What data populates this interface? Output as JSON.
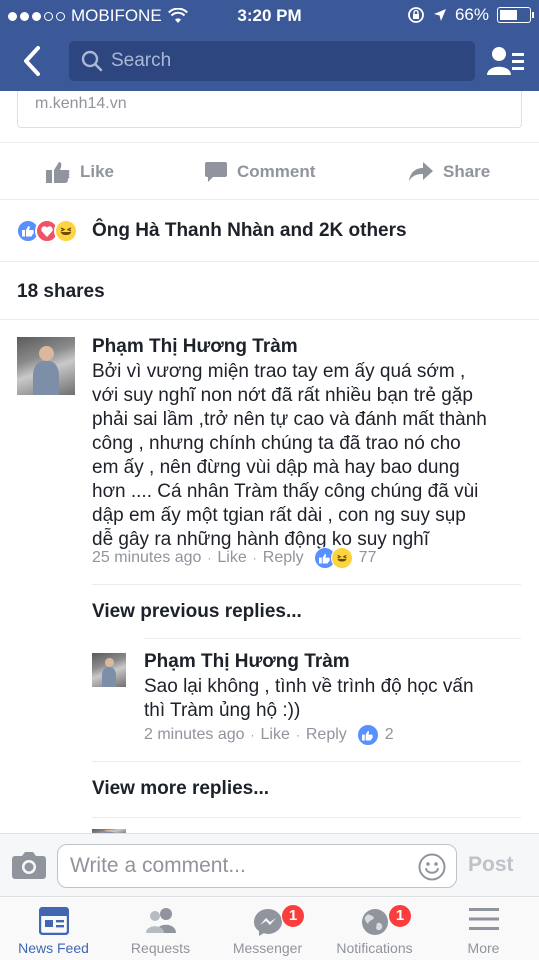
{
  "status_bar": {
    "carrier": "MOBIFONE",
    "time": "3:20 PM",
    "battery": "66%",
    "battery_level": 0.66
  },
  "header": {
    "search_placeholder": "Search"
  },
  "post": {
    "link_domain": "m.kenh14.vn",
    "actions": {
      "like": "Like",
      "comment": "Comment",
      "share": "Share"
    },
    "reactions_text": "Ông Hà Thanh Nhàn and 2K others",
    "shares_text": "18 shares"
  },
  "comments": [
    {
      "author": "Phạm Thị Hương Tràm",
      "lines": [
        "Bởi vì vương miện trao tay em ấy quá sớm ,",
        "với suy nghĩ non nớt đã rất nhiều bạn trẻ gặp",
        "phải sai lầm ,trở nên tự cao và đánh mất thành",
        "công , nhưng chính chúng ta đã trao nó cho",
        "em ấy , nên đừng vùi dập mà hay bao dung",
        "hơn .... Cá nhân Tràm thấy công chúng đã vùi",
        "dập em ấy một tgian rất dài , con ng suy sụp",
        "dễ gây ra những hành động ko suy nghĩ"
      ],
      "time": "25 minutes ago",
      "like": "Like",
      "reply": "Reply",
      "reaction_count": "77"
    }
  ],
  "view_previous": "View previous replies...",
  "reply": {
    "author": "Phạm Thị Hương Tràm",
    "lines": [
      "Sao lại không , tình về trình độ học vấn",
      "thì Tràm ủng hộ :))"
    ],
    "time": "2 minutes ago",
    "like": "Like",
    "reply": "Reply",
    "reaction_count": "2"
  },
  "view_more": "View more replies...",
  "composer": {
    "placeholder": "Write a comment...",
    "post_label": "Post"
  },
  "tabs": [
    {
      "label": "News Feed",
      "icon": "news-feed-icon",
      "active": true
    },
    {
      "label": "Requests",
      "icon": "friend-requests-icon"
    },
    {
      "label": "Messenger",
      "icon": "messenger-icon",
      "badge": "1"
    },
    {
      "label": "Notifications",
      "icon": "globe-icon",
      "badge": "1"
    },
    {
      "label": "More",
      "icon": "hamburger-icon"
    }
  ],
  "colors": {
    "brand": "#3b5998",
    "accent": "#4267b2",
    "badge": "#fa3e3e"
  }
}
